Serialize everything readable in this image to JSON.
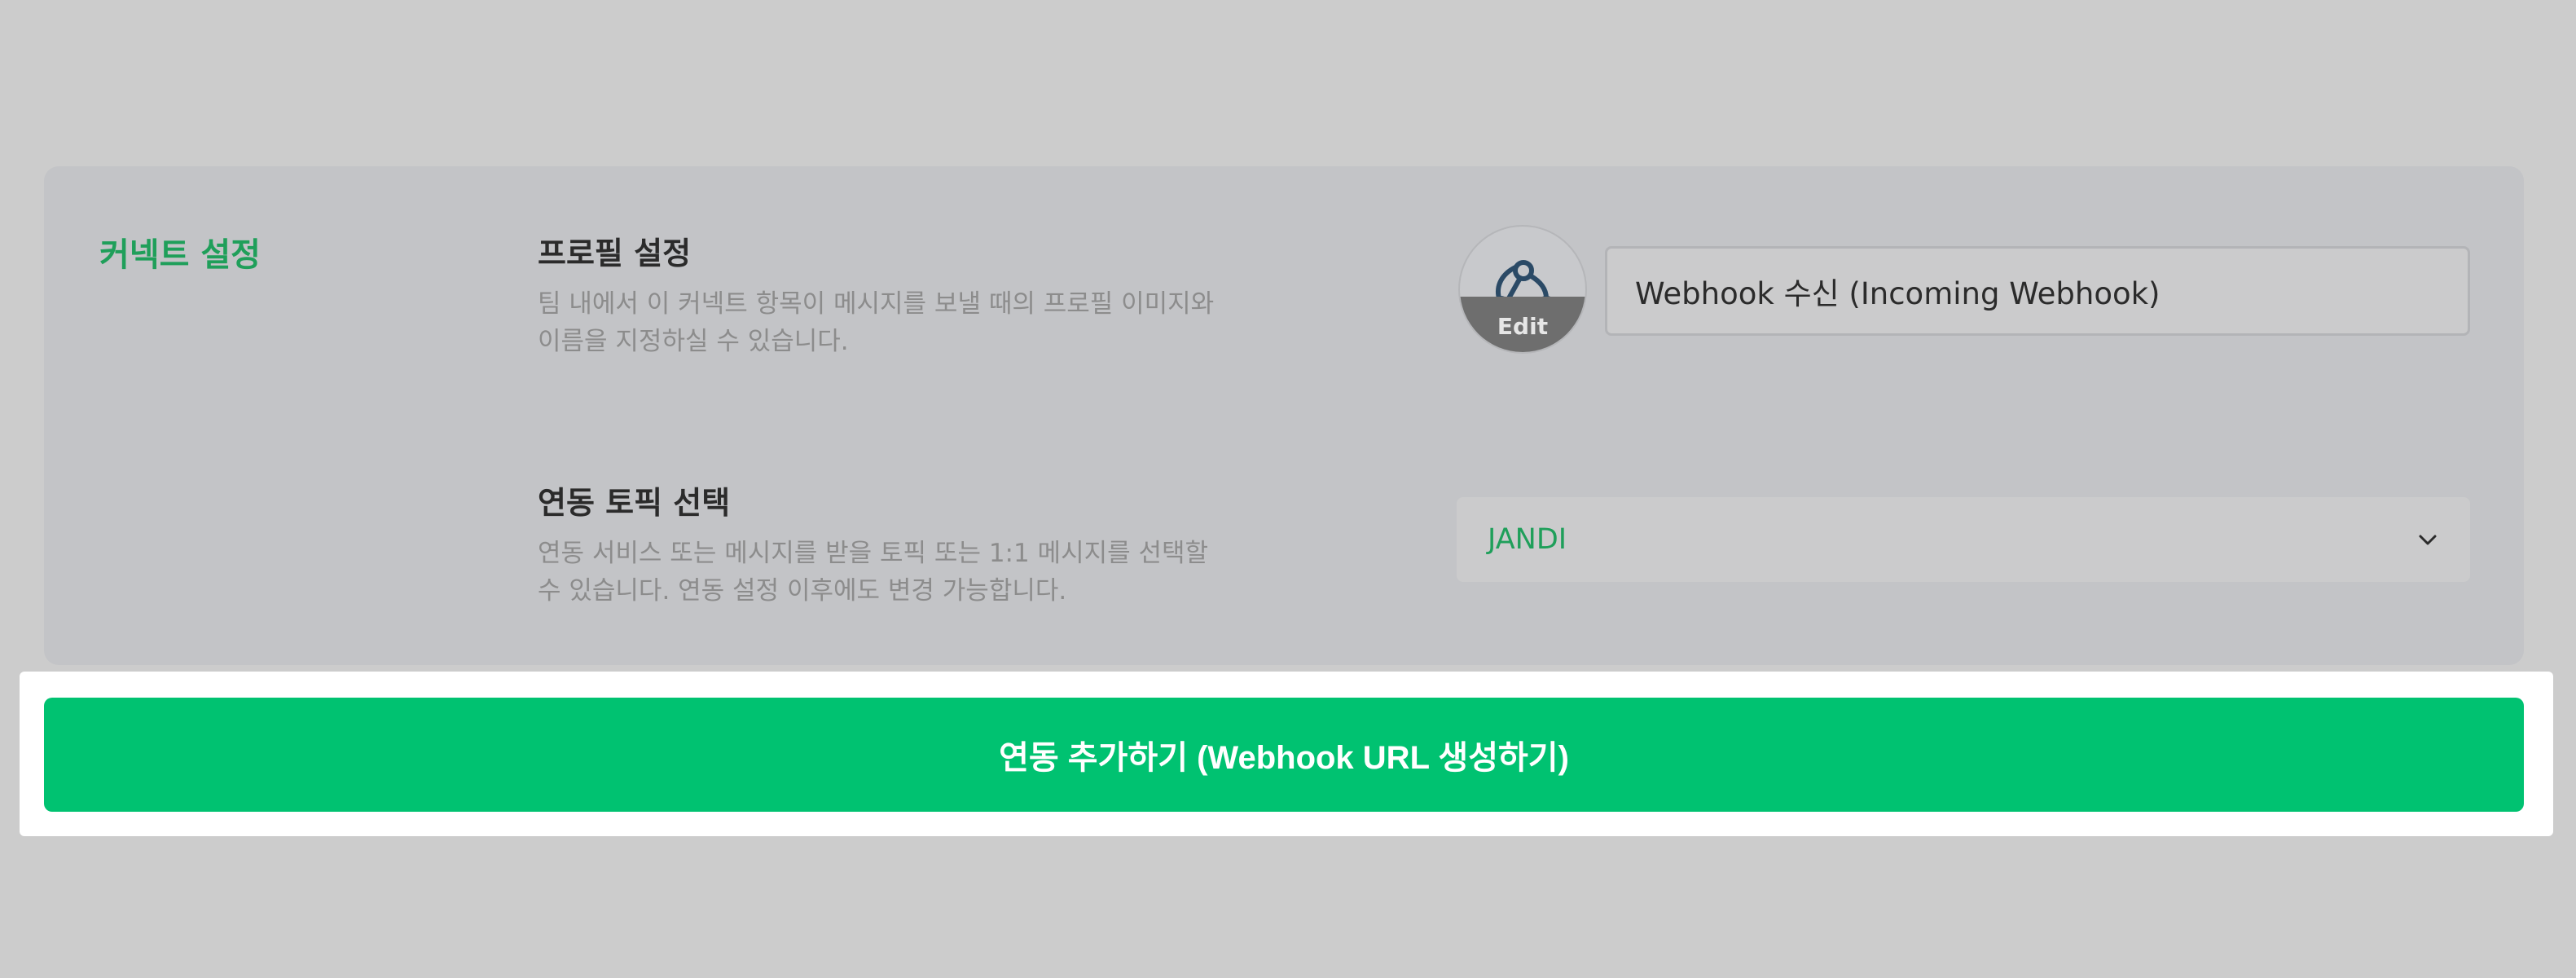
{
  "section": {
    "title": "커넥트 설정"
  },
  "profile": {
    "heading": "프로필 설정",
    "description": "팀 내에서 이 커넥트 항목이 메시지를 보낼 때의 프로필 이미지와 이름을 지정하실 수 있습니다.",
    "avatar_edit_label": "Edit",
    "avatar_icon": "webhook-icon",
    "name_value": "Webhook 수신 (Incoming Webhook)"
  },
  "topic": {
    "heading": "연동 토픽 선택",
    "description": "연동 서비스 또는 메시지를 받을 토픽 또는 1:1 메시지를 선택할 수 있습니다. 연동 설정 이후에도 변경 가능합니다.",
    "selected_value": "JANDI",
    "dropdown_icon": "chevron-down-icon"
  },
  "actions": {
    "submit_label": "연동 추가하기 (Webhook URL 생성하기)"
  },
  "colors": {
    "accent": "#00c271",
    "accent_text": "#1f9f5a"
  }
}
